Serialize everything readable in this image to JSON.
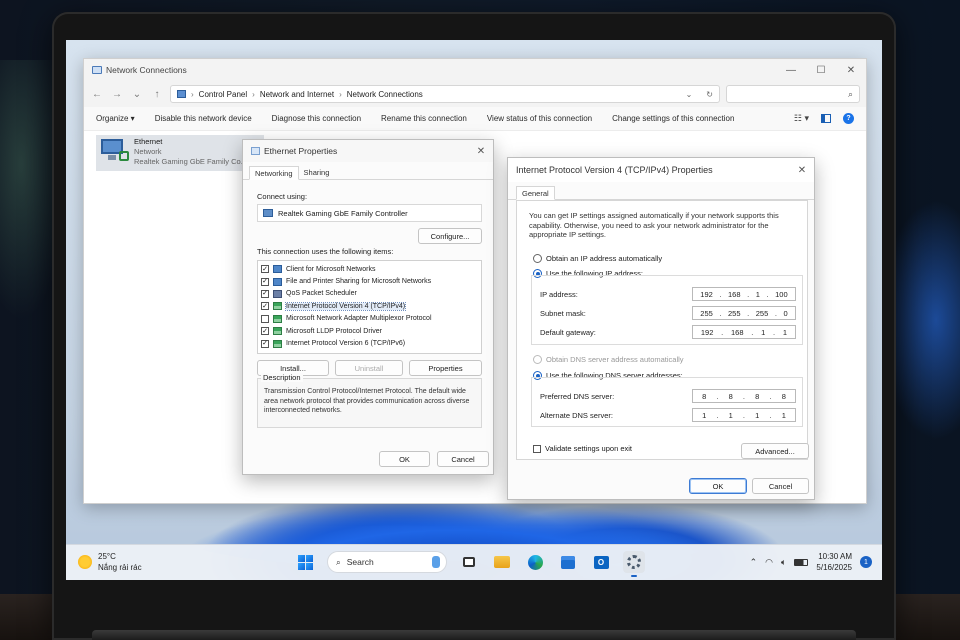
{
  "explorer": {
    "title": "Network Connections",
    "breadcrumb": [
      "Control Panel",
      "Network and Internet",
      "Network Connections"
    ],
    "commands": [
      "Organize ▾",
      "Disable this network device",
      "Diagnose this connection",
      "Rename this connection",
      "View status of this connection",
      "Change settings of this connection"
    ],
    "connection": {
      "name": "Ethernet",
      "status": "Network",
      "adapter": "Realtek Gaming GbE Family Co..."
    }
  },
  "ethernet_properties": {
    "title": "Ethernet Properties",
    "tabs": [
      "Networking",
      "Sharing"
    ],
    "connect_using_label": "Connect using:",
    "adapter_name": "Realtek Gaming GbE Family Controller",
    "configure_button": "Configure...",
    "items_label": "This connection uses the following items:",
    "items": [
      {
        "label": "Client for Microsoft Networks",
        "checked": true,
        "icon": "network-client-icon"
      },
      {
        "label": "File and Printer Sharing for Microsoft Networks",
        "checked": true,
        "icon": "network-client-icon"
      },
      {
        "label": "QoS Packet Scheduler",
        "checked": true,
        "icon": "qos-icon"
      },
      {
        "label": "Internet Protocol Version 4 (TCP/IPv4)",
        "checked": true,
        "icon": "protocol-icon",
        "selected": true
      },
      {
        "label": "Microsoft Network Adapter Multiplexor Protocol",
        "checked": false,
        "icon": "protocol-icon"
      },
      {
        "label": "Microsoft LLDP Protocol Driver",
        "checked": true,
        "icon": "protocol-icon"
      },
      {
        "label": "Internet Protocol Version 6 (TCP/IPv6)",
        "checked": true,
        "icon": "protocol-icon"
      }
    ],
    "install_button": "Install...",
    "uninstall_button": "Uninstall",
    "properties_button": "Properties",
    "description_label": "Description",
    "description_text": "Transmission Control Protocol/Internet Protocol. The default wide area network protocol that provides communication across diverse interconnected networks.",
    "ok_button": "OK",
    "cancel_button": "Cancel"
  },
  "ipv4_properties": {
    "title": "Internet Protocol Version 4 (TCP/IPv4) Properties",
    "tab": "General",
    "intro": "You can get IP settings assigned automatically if your network supports this capability. Otherwise, you need to ask your network administrator for the appropriate IP settings.",
    "obtain_ip_auto": "Obtain an IP address automatically",
    "use_following_ip": "Use the following IP address:",
    "ip_address_label": "IP address:",
    "ip_address": [
      "192",
      "168",
      "1",
      "100"
    ],
    "subnet_mask_label": "Subnet mask:",
    "subnet_mask": [
      "255",
      "255",
      "255",
      "0"
    ],
    "gateway_label": "Default gateway:",
    "gateway": [
      "192",
      "168",
      "1",
      "1"
    ],
    "obtain_dns_auto": "Obtain DNS server address automatically",
    "use_following_dns": "Use the following DNS server addresses:",
    "preferred_dns_label": "Preferred DNS server:",
    "preferred_dns": [
      "8",
      "8",
      "8",
      "8"
    ],
    "alternate_dns_label": "Alternate DNS server:",
    "alternate_dns": [
      "1",
      "1",
      "1",
      "1"
    ],
    "validate_label": "Validate settings upon exit",
    "validate_checked": false,
    "advanced_button": "Advanced...",
    "ok_button": "OK",
    "cancel_button": "Cancel"
  },
  "taskbar": {
    "temperature": "25°C",
    "weather": "Nắng rải rác",
    "search_label": "Search",
    "time": "10:30 AM",
    "date": "5/16/2025",
    "notification_count": "1"
  }
}
